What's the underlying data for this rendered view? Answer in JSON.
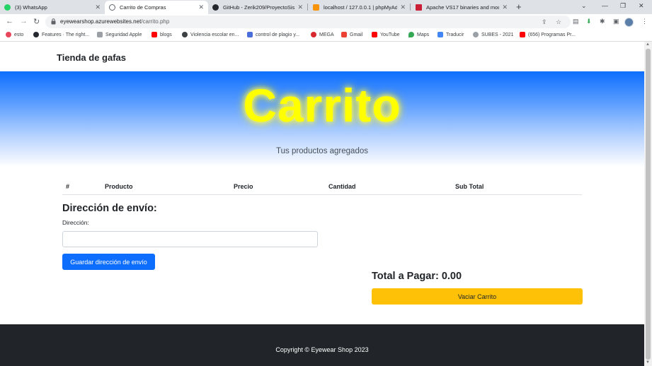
{
  "tabs": [
    {
      "title": "(3) WhatsApp",
      "active": false,
      "favicon_color": "#25d366"
    },
    {
      "title": "Carrito de Compras",
      "active": true,
      "favicon_color": "#5f6368"
    },
    {
      "title": "GitHub - Zerik209/ProyectoSisDi",
      "active": false,
      "favicon_color": "#24292f"
    },
    {
      "title": "localhost / 127.0.0.1 | phpMyAdm",
      "active": false,
      "favicon_color": "#f89406"
    },
    {
      "title": "Apache VS17 binaries and modu",
      "active": false,
      "favicon_color": "#c92037"
    }
  ],
  "toolbar": {
    "url_host": "eyewearshop.azurewebsites.net",
    "url_path": "/carrito.php"
  },
  "bookmarks": [
    {
      "label": "esto",
      "icon": "heart-icon",
      "color": "#e8465b"
    },
    {
      "label": "Features · The right...",
      "icon": "github-icon",
      "color": "#24292f"
    },
    {
      "label": "Seguridad Apple",
      "icon": "apple-icon",
      "color": "#9aa0a6"
    },
    {
      "label": "blogs",
      "icon": "youtube-icon",
      "color": "#ff0000"
    },
    {
      "label": "Violencia escolar en...",
      "icon": "globe-icon",
      "color": "#3c4043"
    },
    {
      "label": "control de plagio y...",
      "icon": "chart-icon",
      "color": "#4a6fd8"
    },
    {
      "label": "MEGA",
      "icon": "mega-icon",
      "color": "#d9272e"
    },
    {
      "label": "Gmail",
      "icon": "gmail-icon",
      "color": "#ea4335"
    },
    {
      "label": "YouTube",
      "icon": "youtube-icon",
      "color": "#ff0000"
    },
    {
      "label": "Maps",
      "icon": "maps-icon",
      "color": "#34a853"
    },
    {
      "label": "Traducir",
      "icon": "translate-icon",
      "color": "#4285f4"
    },
    {
      "label": "SUBES - 2021",
      "icon": "subes-icon",
      "color": "#9aa0a6"
    },
    {
      "label": "(656) Programas Pr...",
      "icon": "youtube-icon",
      "color": "#ff0000"
    }
  ],
  "site": {
    "brand": "Tienda de gafas",
    "hero_title": "Carrito",
    "hero_subtitle": "Tus productos agregados"
  },
  "table": {
    "headers": [
      "#",
      "Producto",
      "Precio",
      "Cantidad",
      "Sub Total"
    ]
  },
  "shipping": {
    "title": "Dirección de envío:",
    "label": "Dirección:",
    "value": "",
    "save_label": "Guardar dirección de envío"
  },
  "summary": {
    "total_text": "Total a Pagar: 0.00",
    "empty_label": "Vaciar Carrito"
  },
  "footer": {
    "text": "Copyright © Eyewear Shop 2023"
  },
  "colors": {
    "primary": "#0d6efd",
    "warning": "#ffc107",
    "hero_text": "#ffff00",
    "footer_bg": "#212529"
  }
}
